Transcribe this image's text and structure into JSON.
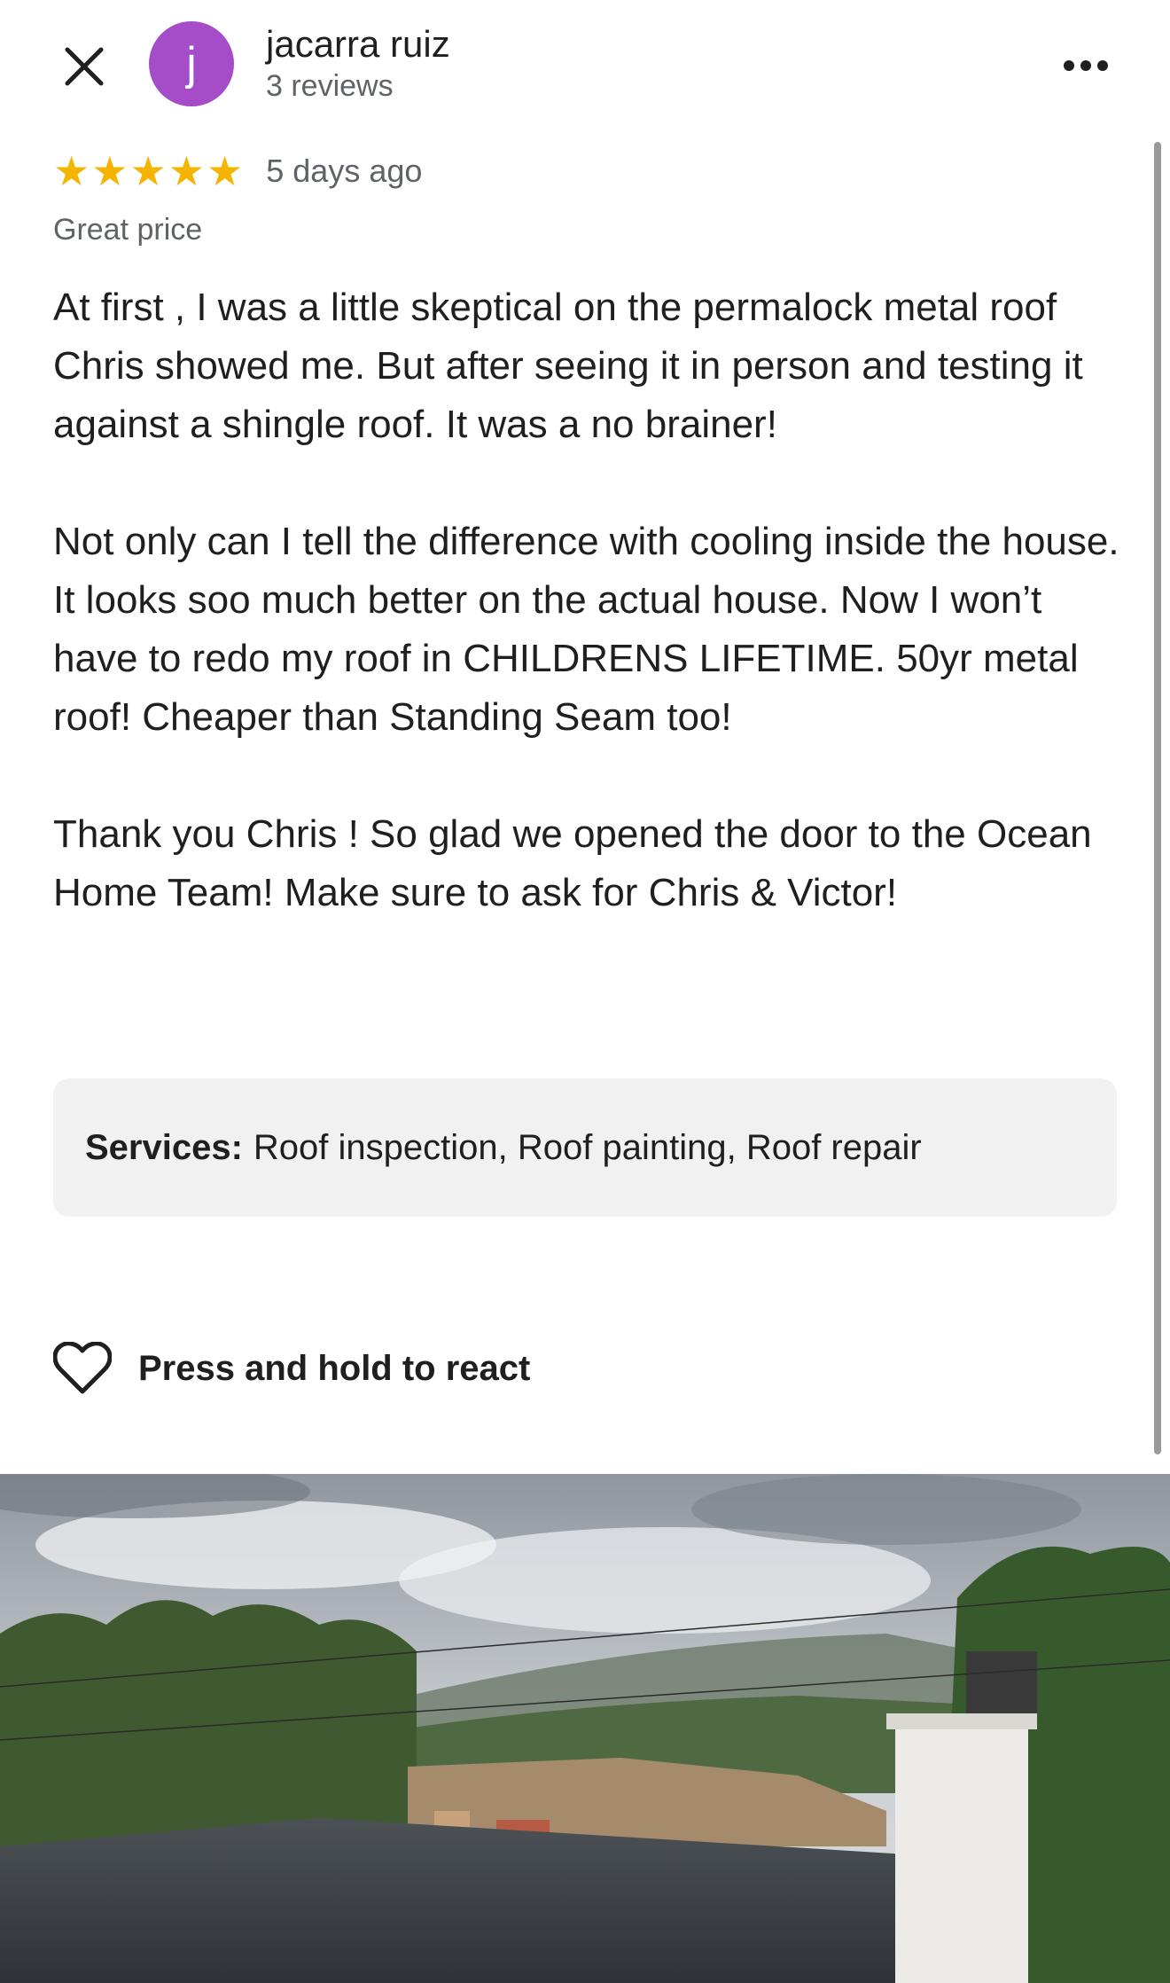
{
  "header": {
    "avatar_letter": "j",
    "user_name": "jacarra ruiz",
    "user_reviews": "3 reviews"
  },
  "review": {
    "rating": 5,
    "stars": [
      "★",
      "★",
      "★",
      "★",
      "★"
    ],
    "time": "5 days ago",
    "highlight": "Great price",
    "paragraphs": [
      "At first , I was a little skeptical on the permalock metal roof Chris showed me. But after seeing it in person and testing it against a shingle roof. It was a no brainer!",
      "Not only can I tell the difference with cooling inside the house. It looks soo much better on the actual house. Now I won’t have to redo my roof in CHILDRENS LIFETIME. 50yr metal roof! Cheaper than Standing Seam too!",
      "Thank you Chris ! So glad we opened the door to the Ocean Home Team! Make sure to ask for Chris & Victor!"
    ],
    "services_label": "Services:",
    "services_value": "Roof inspection, Roof painting, Roof repair"
  },
  "actions": {
    "react_label": "Press and hold to react"
  },
  "colors": {
    "avatar": "#a54dc9",
    "star": "#f4b400",
    "secondary_text": "#5f6368"
  },
  "icons": [
    "close-icon",
    "more-options-icon",
    "heart-icon"
  ]
}
